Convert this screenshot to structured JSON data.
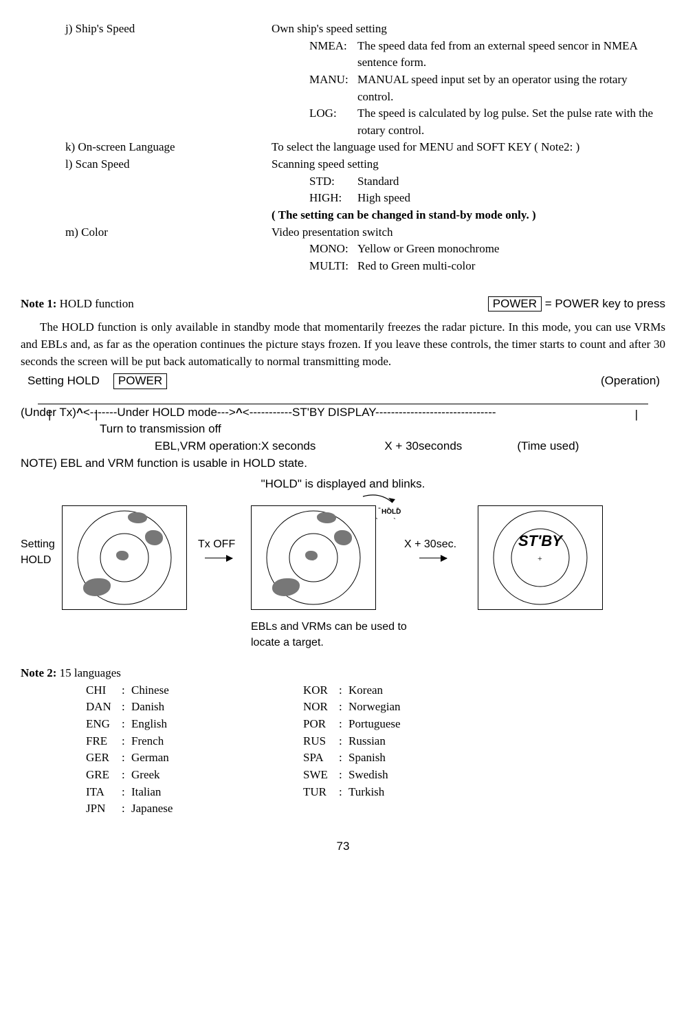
{
  "items": {
    "j": {
      "label": "j) Ship's Speed",
      "body": "Own ship's speed setting",
      "subs": [
        {
          "label": "NMEA:",
          "body": "The speed data fed from an external speed sencor in NMEA sentence form."
        },
        {
          "label": "MANU:",
          "body": "MANUAL speed input set by an operator using the rotary control."
        },
        {
          "label": "LOG:",
          "body": "The speed is calculated by log pulse. Set the pulse rate with the rotary control."
        }
      ]
    },
    "k": {
      "label": "k) On-screen Language",
      "body": "To select the language used for MENU and SOFT KEY ( Note2: )"
    },
    "l": {
      "label": "l) Scan Speed",
      "body": "Scanning speed setting",
      "subs": [
        {
          "label": "STD:",
          "body": "Standard"
        },
        {
          "label": "HIGH:",
          "body": "High speed"
        }
      ],
      "note": "( The setting can be changed in stand-by mode only. )"
    },
    "m": {
      "label": "m) Color",
      "body": "Video presentation switch",
      "subs": [
        {
          "label": "MONO:",
          "body": "Yellow or Green monochrome"
        },
        {
          "label": "MULTI:",
          "body": "Red to Green multi-color"
        }
      ]
    }
  },
  "note1": {
    "title": "Note 1:",
    "subject": " HOLD function",
    "key": "POWER",
    "keytext": " = POWER key to press",
    "para": "The HOLD function is only available in standby mode that momentarily freezes the radar picture. In this mode, you can use VRMs and EBLs and, as far as the operation continues the picture stays frozen. If you leave these controls, the timer starts to count and after 30 seconds the screen will be put back automatically to normal transmitting mode."
  },
  "hold": {
    "setting": "Setting HOLD",
    "power": "POWER",
    "operation": "(Operation)",
    "underTx": "(Under Tx)",
    "underHold": "<-------Under HOLD mode--->",
    "stby": "<-----------ST'BY DISPLAY-------------------------------",
    "txoffline": "Turn to transmission off",
    "eblop": "EBL,VRM operation:X seconds",
    "x30": "X + 30seconds",
    "time": "(Time used)",
    "noteebl": "NOTE) EBL and VRM function is usable in HOLD state.",
    "blinks": "\"HOLD\" is displayed and blinks.",
    "diag": {
      "settingHold": "Setting\nHOLD",
      "txoff": "Tx OFF",
      "x30s": "X + 30sec.",
      "stbyLabel": "ST'BY",
      "holdPill": "HOLD"
    },
    "footnote": "EBLs and VRMs can be used to locate a target."
  },
  "note2": {
    "title": "Note 2:",
    "subtitle": "  15 languages",
    "left": [
      {
        "code": "CHI",
        "name": "Chinese"
      },
      {
        "code": "DAN",
        "name": "Danish"
      },
      {
        "code": "ENG",
        "name": "English"
      },
      {
        "code": "FRE",
        "name": "French"
      },
      {
        "code": "GER",
        "name": "German"
      },
      {
        "code": "GRE",
        "name": "Greek"
      },
      {
        "code": "ITA",
        "name": "Italian"
      },
      {
        "code": "JPN",
        "name": "Japanese"
      }
    ],
    "right": [
      {
        "code": "KOR",
        "name": "Korean"
      },
      {
        "code": "NOR",
        "name": "Norwegian"
      },
      {
        "code": "POR",
        "name": "Portuguese"
      },
      {
        "code": "RUS",
        "name": "Russian"
      },
      {
        "code": "SPA",
        "name": "Spanish"
      },
      {
        "code": "SWE",
        "name": "Swedish"
      },
      {
        "code": "TUR",
        "name": "Turkish"
      }
    ]
  },
  "page": "73"
}
